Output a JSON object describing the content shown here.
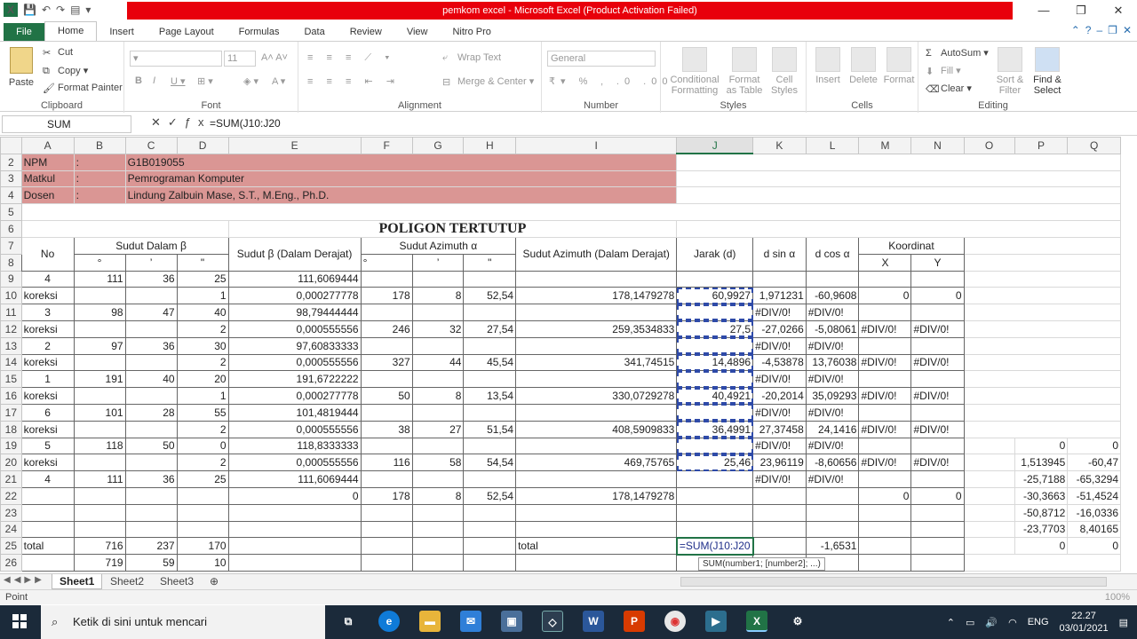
{
  "window": {
    "title": "pemkom excel  -  Microsoft Excel (Product Activation Failed)"
  },
  "tabs": [
    "File",
    "Home",
    "Insert",
    "Page Layout",
    "Formulas",
    "Data",
    "Review",
    "View",
    "Nitro Pro"
  ],
  "ribbon": {
    "clipboard": {
      "paste": "Paste",
      "cut": "Cut",
      "copy": "Copy",
      "format_painter": "Format Painter",
      "label": "Clipboard"
    },
    "font": {
      "size": "11",
      "label": "Font"
    },
    "alignment": {
      "wrap": "Wrap Text",
      "merge": "Merge & Center",
      "label": "Alignment"
    },
    "number": {
      "format": "General",
      "label": "Number"
    },
    "styles": {
      "cond": "Conditional Formatting",
      "table": "Format as Table",
      "cell": "Cell Styles",
      "label": "Styles"
    },
    "cells": {
      "insert": "Insert",
      "delete": "Delete",
      "format": "Format",
      "label": "Cells"
    },
    "editing": {
      "autosum": "AutoSum",
      "fill": "Fill",
      "clear": "Clear",
      "sort": "Sort & Filter",
      "find": "Find & Select",
      "label": "Editing"
    }
  },
  "formula_bar": {
    "name_box": "SUM",
    "formula": "=SUM(J10:J20"
  },
  "columns": [
    "A",
    "B",
    "C",
    "D",
    "E",
    "F",
    "G",
    "H",
    "I",
    "J",
    "K",
    "L",
    "M",
    "N",
    "O",
    "P",
    "Q"
  ],
  "selected_column": "J",
  "rows": {
    "r2": {
      "n": "2",
      "a": "NPM",
      "b": ":",
      "c": "G1B019055"
    },
    "r3": {
      "n": "3",
      "a": "Matkul",
      "b": ":",
      "c": "Pemrograman Komputer"
    },
    "r4": {
      "n": "4",
      "a": "Dosen",
      "b": ":",
      "c": "Lindung Zalbuin Mase, S.T., M.Eng., Ph.D."
    },
    "r5": {
      "n": "5"
    },
    "r6": {
      "n": "6",
      "title": "POLIGON TERTUTUP"
    },
    "r7": {
      "n": "7",
      "no": "No",
      "sudut_dalam": "Sudut Dalam β",
      "sudut_beta": "Sudut β (Dalam Derajat)",
      "sudut_az": "Sudut Azimuth α",
      "az_deg": "Sudut Azimuth (Dalam Derajat)",
      "jarak": "Jarak (d)",
      "dsin": "d sin α",
      "dcos": "d cos α",
      "koordinat": "Koordinat"
    },
    "r8": {
      "n": "8",
      "deg": "°",
      "min": "’",
      "sec": "\"",
      "adeg": "°",
      "amin": "’",
      "asec": "\"",
      "x": "X",
      "y": "Y"
    },
    "r9": {
      "n": "9",
      "a": "4",
      "b": "111",
      "c": "36",
      "d": "25",
      "e": "111,6069444"
    },
    "r10": {
      "n": "10",
      "a": "koreksi",
      "d": "1",
      "e": "0,000277778",
      "f": "178",
      "g": "8",
      "h": "52,54",
      "i": "178,1479278",
      "j": "60,9927",
      "k": "1,971231",
      "l": "-60,9608",
      "m": "0",
      "nn": "0"
    },
    "r11": {
      "n": "11",
      "a": "3",
      "b": "98",
      "c": "47",
      "d": "40",
      "e": "98,79444444",
      "k": "#DIV/0!",
      "l": "#DIV/0!"
    },
    "r12": {
      "n": "12",
      "a": "koreksi",
      "d": "2",
      "e": "0,000555556",
      "f": "246",
      "g": "32",
      "h": "27,54",
      "i": "259,3534833",
      "j": "27,5",
      "k": "-27,0266",
      "l": "-5,08061",
      "m": "#DIV/0!",
      "nn": "#DIV/0!"
    },
    "r13": {
      "n": "13",
      "a": "2",
      "b": "97",
      "c": "36",
      "d": "30",
      "e": "97,60833333",
      "k": "#DIV/0!",
      "l": "#DIV/0!"
    },
    "r14": {
      "n": "14",
      "a": "koreksi",
      "d": "2",
      "e": "0,000555556",
      "f": "327",
      "g": "44",
      "h": "45,54",
      "i": "341,74515",
      "j": "14,4896",
      "k": "-4,53878",
      "l": "13,76038",
      "m": "#DIV/0!",
      "nn": "#DIV/0!"
    },
    "r15": {
      "n": "15",
      "a": "1",
      "b": "191",
      "c": "40",
      "d": "20",
      "e": "191,6722222",
      "k": "#DIV/0!",
      "l": "#DIV/0!"
    },
    "r16": {
      "n": "16",
      "a": "koreksi",
      "d": "1",
      "e": "0,000277778",
      "f": "50",
      "g": "8",
      "h": "13,54",
      "i": "330,0729278",
      "j": "40,4921",
      "k": "-20,2014",
      "l": "35,09293",
      "m": "#DIV/0!",
      "nn": "#DIV/0!"
    },
    "r17": {
      "n": "17",
      "a": "6",
      "b": "101",
      "c": "28",
      "d": "55",
      "e": "101,4819444",
      "k": "#DIV/0!",
      "l": "#DIV/0!"
    },
    "r18": {
      "n": "18",
      "a": "koreksi",
      "d": "2",
      "e": "0,000555556",
      "f": "38",
      "g": "27",
      "h": "51,54",
      "i": "408,5909833",
      "j": "36,4991",
      "k": "27,37458",
      "l": "24,1416",
      "m": "#DIV/0!",
      "nn": "#DIV/0!"
    },
    "r19": {
      "n": "19",
      "a": "5",
      "b": "118",
      "c": "50",
      "d": "0",
      "e": "118,8333333",
      "k": "#DIV/0!",
      "l": "#DIV/0!",
      "p": "0",
      "q": "0"
    },
    "r20": {
      "n": "20",
      "a": "koreksi",
      "d": "2",
      "e": "0,000555556",
      "f": "116",
      "g": "58",
      "h": "54,54",
      "i": "469,75765",
      "j": "25,46",
      "k": "23,96119",
      "l": "-8,60656",
      "m": "#DIV/0!",
      "nn": "#DIV/0!",
      "p": "1,513945",
      "q": "-60,47"
    },
    "r21": {
      "n": "21",
      "a": "4",
      "b": "111",
      "c": "36",
      "d": "25",
      "e": "111,6069444",
      "k": "#DIV/0!",
      "l": "#DIV/0!",
      "p": "-25,7188",
      "q": "-65,3294"
    },
    "r22": {
      "n": "22",
      "e": "0",
      "f": "178",
      "g": "8",
      "h": "52,54",
      "i": "178,1479278",
      "m": "0",
      "nn": "0",
      "p": "-30,3663",
      "q": "-51,4524"
    },
    "r23": {
      "n": "23",
      "p": "-50,8712",
      "q": "-16,0336"
    },
    "r24": {
      "n": "24",
      "p": "-23,7703",
      "q": "8,40165"
    },
    "r25": {
      "n": "25",
      "a": "total",
      "b": "716",
      "c": "237",
      "d": "170",
      "i": "total",
      "j": "=SUM(J10:J20",
      "l": "-1,6531",
      "p": "0",
      "q": "0"
    },
    "r26": {
      "n": "26",
      "b": "719",
      "c": "59",
      "d": "10"
    }
  },
  "tooltip": "SUM(number1; [number2]; ...)",
  "sheets": [
    "Sheet1",
    "Sheet2",
    "Sheet3"
  ],
  "status": {
    "mode": "Point",
    "zoom": "100%"
  },
  "taskbar": {
    "search_placeholder": "Ketik di sini untuk mencari",
    "lang": "ENG",
    "time": "22.27",
    "date": "03/01/2021"
  },
  "colors": {
    "excel_green": "#217346",
    "title_red": "#e8000b",
    "pink_fill": "#da9694"
  }
}
